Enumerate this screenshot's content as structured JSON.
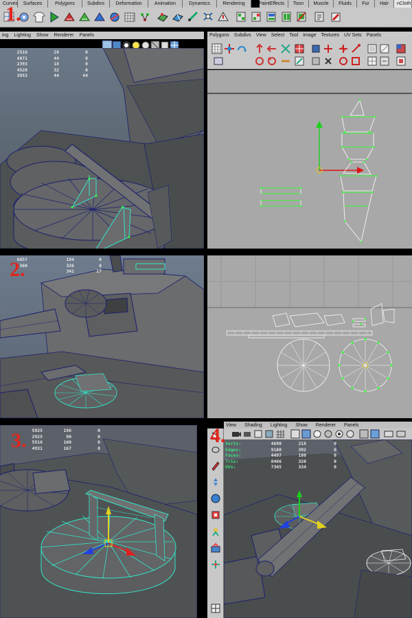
{
  "shelf": {
    "tabs": [
      "Curves",
      "Surfaces",
      "Polygons",
      "Subdivs",
      "Deformation",
      "Animation",
      "Dynamics",
      "Rendering",
      "PaintEffects",
      "Toon",
      "Muscle",
      "Fluids",
      "Fur",
      "Hair",
      "nCloth"
    ],
    "active_tab": "nCloth"
  },
  "steps": [
    "1.",
    "2.",
    "3.",
    "4."
  ],
  "panel1": {
    "menu": [
      "ing",
      "Lighting",
      "Show",
      "Renderer",
      "Panels"
    ],
    "stats": [
      [
        "2516",
        "28",
        "0"
      ],
      [
        "4871",
        "44",
        "0"
      ],
      [
        "2393",
        "18",
        "0"
      ],
      [
        "4520",
        "32",
        "0"
      ],
      [
        "3953",
        "44",
        "44"
      ]
    ]
  },
  "uv_editor": {
    "menu": [
      "Polygons",
      "Subdivs",
      "View",
      "Select",
      "Tool",
      "Image",
      "Textures",
      "UV Sets",
      "Panels"
    ]
  },
  "panel2": {
    "stats": [
      [
        "6857",
        "194",
        "0"
      ],
      [
        "360",
        "336",
        "0"
      ],
      [
        "",
        "341",
        "17"
      ]
    ]
  },
  "panel3": {
    "stats": [
      [
        "5925",
        "196",
        "0"
      ],
      [
        "2925",
        "90",
        "0"
      ],
      [
        "5516",
        "160",
        "0"
      ],
      [
        "4931",
        "167",
        "0"
      ]
    ]
  },
  "panel4": {
    "menu": [
      "View",
      "Shading",
      "Lighting",
      "Show",
      "Renderer",
      "Panels"
    ],
    "stats_labels": [
      "Verts:",
      "Edges:",
      "Faces:",
      "Tris:",
      "UVs:"
    ],
    "stats": [
      [
        "4690",
        "218",
        "0"
      ],
      [
        "9108",
        "392",
        "0"
      ],
      [
        "4497",
        "180",
        "0"
      ],
      [
        "8466",
        "320",
        "0"
      ],
      [
        "7365",
        "334",
        "0"
      ]
    ]
  },
  "colors": {
    "wire_selected": "#33e6c8",
    "wire_dark": "#1a1f6e",
    "vertex": "#33ff33",
    "step_label": "#e0261c",
    "uv_bg": "#a8a8a8",
    "viewport_sky": "#6d7c8e"
  }
}
